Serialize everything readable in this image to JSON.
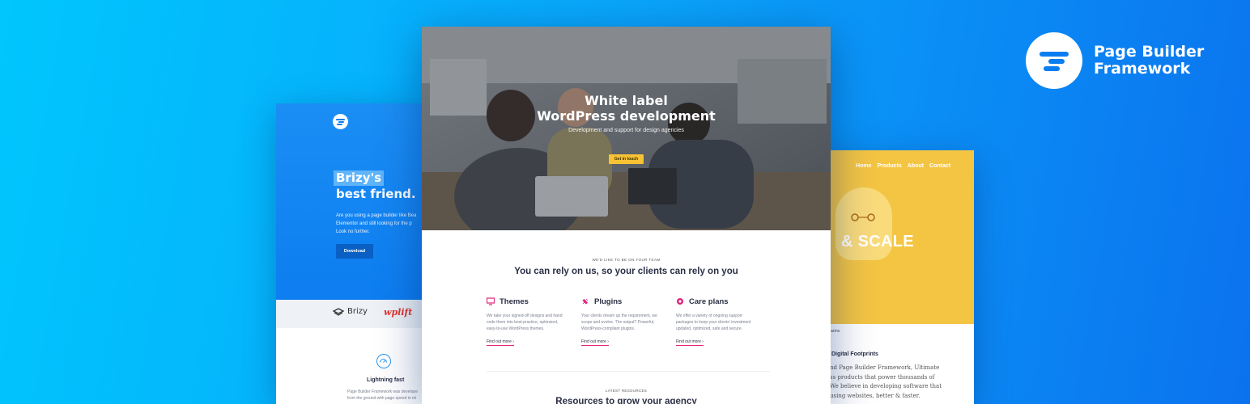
{
  "brand": {
    "name_line1": "Page Builder",
    "name_line2": "Framework"
  },
  "left_card": {
    "headline_highlight": "Brizy's",
    "headline_rest": "best friend.",
    "paragraph_lines": [
      "Are you using a page builder like Bea",
      "Elementor and still looking for the p",
      "Look no further."
    ],
    "download_label": "Download",
    "partner_logos": [
      "Brizy",
      "wplift"
    ],
    "feature_title": "Lightning fast",
    "feature_text_lines": [
      "Page Builder Framework was develope",
      "from the ground with page-speed in mi"
    ]
  },
  "center_card": {
    "hero_title_line1": "White label",
    "hero_title_line2": "WordPress development",
    "hero_subtitle": "Development and support for design agencies",
    "hero_button": "Get in touch",
    "eyebrow": "WE'D LIKE TO BE ON YOUR TEAM",
    "section_title": "You can rely on us, so your clients can rely on you",
    "services": [
      {
        "title": "Themes",
        "icon": "monitor-icon",
        "text": [
          "We take your signed-off designs and hand",
          "code them into best-practice, optimized,",
          "easy-to-use WordPress themes."
        ],
        "link": "Find out more ›"
      },
      {
        "title": "Plugins",
        "icon": "plug-icon",
        "text": [
          "Your clients dream up the requirement, we",
          "scope and evolve. The output? Powerful,",
          "WordPress-compliant plugins."
        ],
        "link": "Find out more ›"
      },
      {
        "title": "Care plans",
        "icon": "globe-icon",
        "text": [
          "We offer a variety of ongoing support",
          "packages to keep your clients' investment",
          "updated, optimized, safe and secure."
        ],
        "link": "Find out more ›"
      }
    ],
    "eyebrow2": "LATEST RESOURCES",
    "section_title2": "Resources to grow your agency"
  },
  "right_card": {
    "nav": [
      "Home",
      "Products",
      "About",
      "Contact"
    ],
    "hero_text": "& SCALE",
    "small_label": "arms",
    "heading": "Digital Footprints",
    "text_lines": [
      "nd Page Builder Framework, Ultimate",
      "ss products that power thousands of",
      "We believe in developing software that",
      "using websites, better & faster."
    ]
  },
  "colors": {
    "accent_blue": "#0d7df0",
    "accent_yellow": "#f4c543",
    "accent_pink": "#e0227b",
    "button_yellow": "#f7c234"
  }
}
